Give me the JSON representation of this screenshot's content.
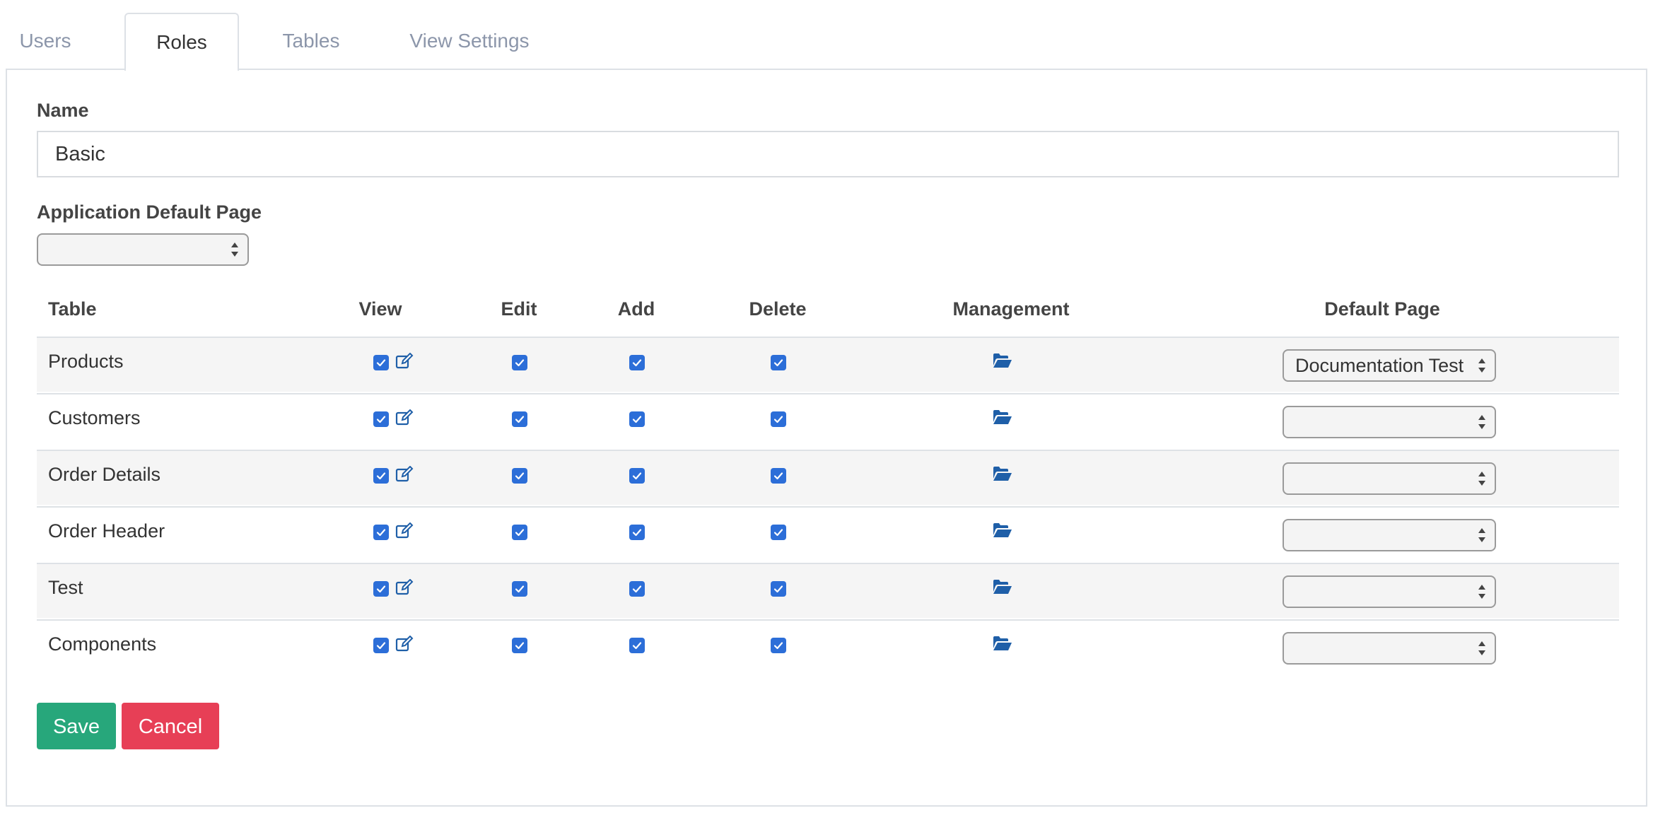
{
  "tabs": [
    {
      "label": "Users",
      "active": false
    },
    {
      "label": "Roles",
      "active": true
    },
    {
      "label": "Tables",
      "active": false
    },
    {
      "label": "View Settings",
      "active": false
    }
  ],
  "form": {
    "name_label": "Name",
    "name_value": "Basic",
    "default_page_label": "Application Default Page",
    "default_page_value": ""
  },
  "table": {
    "headers": {
      "table": "Table",
      "view": "View",
      "edit": "Edit",
      "add": "Add",
      "delete": "Delete",
      "management": "Management",
      "default_page": "Default Page"
    },
    "rows": [
      {
        "name": "Products",
        "view": true,
        "edit": true,
        "add": true,
        "delete": true,
        "default_page": "Documentation Test"
      },
      {
        "name": "Customers",
        "view": true,
        "edit": true,
        "add": true,
        "delete": true,
        "default_page": ""
      },
      {
        "name": "Order Details",
        "view": true,
        "edit": true,
        "add": true,
        "delete": true,
        "default_page": ""
      },
      {
        "name": "Order Header",
        "view": true,
        "edit": true,
        "add": true,
        "delete": true,
        "default_page": ""
      },
      {
        "name": "Test",
        "view": true,
        "edit": true,
        "add": true,
        "delete": true,
        "default_page": ""
      },
      {
        "name": "Components",
        "view": true,
        "edit": true,
        "add": true,
        "delete": true,
        "default_page": ""
      }
    ]
  },
  "buttons": {
    "save": "Save",
    "cancel": "Cancel"
  },
  "icons": {
    "view_extra": "edit-icon",
    "management": "folder-open-icon"
  },
  "colors": {
    "checkbox": "#2c6ed8",
    "icon": "#1f5fa8",
    "save": "#27a77b",
    "cancel": "#e73f56",
    "tab_inactive": "#8c96aa"
  }
}
